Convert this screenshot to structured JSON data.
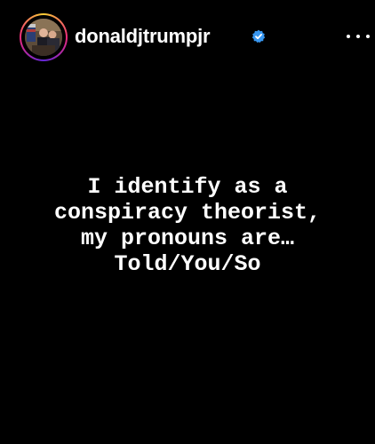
{
  "header": {
    "username": "donaldjtrumpjr",
    "verified_icon": "verified-badge-icon",
    "more_icon": "more-options-icon",
    "avatar": "profile-avatar-image"
  },
  "story": {
    "text": "I identify as a\nconspiracy theorist,\nmy pronouns are…\nTold/You/So"
  },
  "colors": {
    "background": "#000000",
    "text": "#ffffff",
    "verified": "#3897f0",
    "story_ring": [
      "#f9ce34",
      "#ee2a7b",
      "#6228d7"
    ]
  }
}
